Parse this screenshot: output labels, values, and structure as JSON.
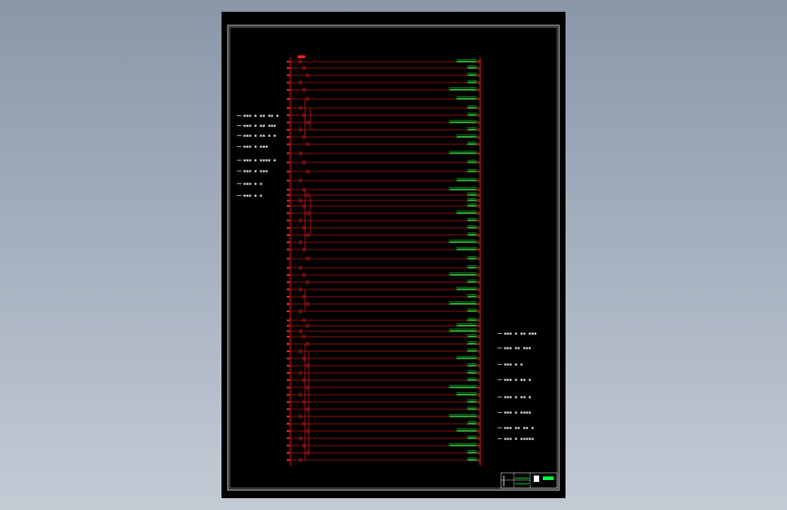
{
  "colors": {
    "background_top": "#8a97a9",
    "background_bottom": "#c3cbd5",
    "sheet": "#000000",
    "border": "#ffffff",
    "wire": "#ff2020",
    "device_label": "#00ff40",
    "text": "#ffffff"
  },
  "drawing": {
    "type": "ladder-diagram",
    "left_notes": [
      "▪▪▪ ▪ ▪▪ ▪▪ ▪",
      "▪▪▪ ▪ ▪▪ ▪▪▪",
      "▪▪▪ ▪ ▪▪ ▪ ▪",
      "▪▪▪ ▪ ▪▪▪",
      "▪▪▪ ▪ ▪▪▪▪ ▪",
      "▪▪▪ ▪ ▪▪▪",
      "▪▪▪ ▪ ▪",
      "▪▪▪ ▪ ▪"
    ],
    "right_notes": [
      "▪▪▪ ▪ ▪▪ ▪▪▪",
      "▪▪▪ ▪▪ ▪▪▪",
      "▪▪▪ ▪ ▪",
      "▪▪▪ ▪ ▪▪ ▪",
      "▪▪▪ ▪ ▪▪ ▪",
      "▪▪▪ ▪ ▪▪▪▪",
      "▪▪▪ ▪▪ ▪▪ ▪",
      "▪▪▪ ▪ ▪▪▪▪▪"
    ]
  }
}
